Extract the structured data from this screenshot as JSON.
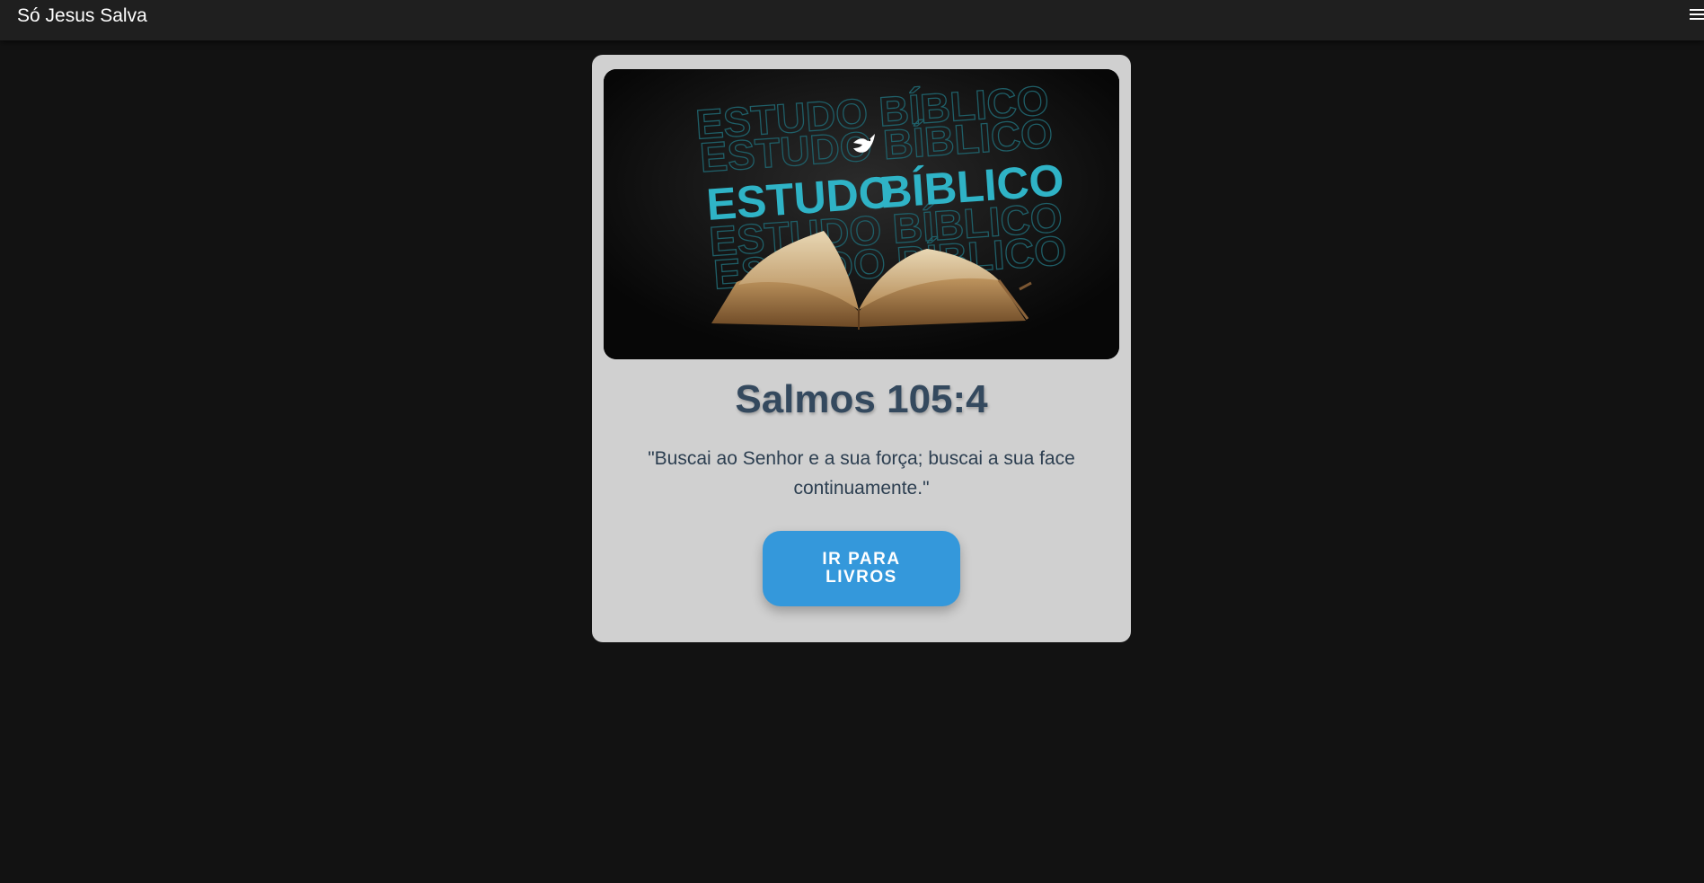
{
  "navbar": {
    "brand": "Só Jesus Salva",
    "menu_icon": "hamburger-menu-icon"
  },
  "card": {
    "banner": {
      "title_word_1": "ESTUDO",
      "title_word_2": "BÍBLICO",
      "background_text": "ESTUDO BÍBLICO",
      "icon": "dove-icon",
      "accent_color": "#2fb3c6"
    },
    "verse_reference": "Salmos 105:4",
    "verse_text": "\"Buscai ao Senhor e a sua força; buscai a sua face continuamente.\"",
    "button_label": "IR PARA LIVROS",
    "button_color": "#3498db"
  },
  "colors": {
    "page_background": "#121212",
    "navbar_background": "#1f1f1f",
    "card_background": "#d0d0d0",
    "heading_color": "#34495e"
  }
}
